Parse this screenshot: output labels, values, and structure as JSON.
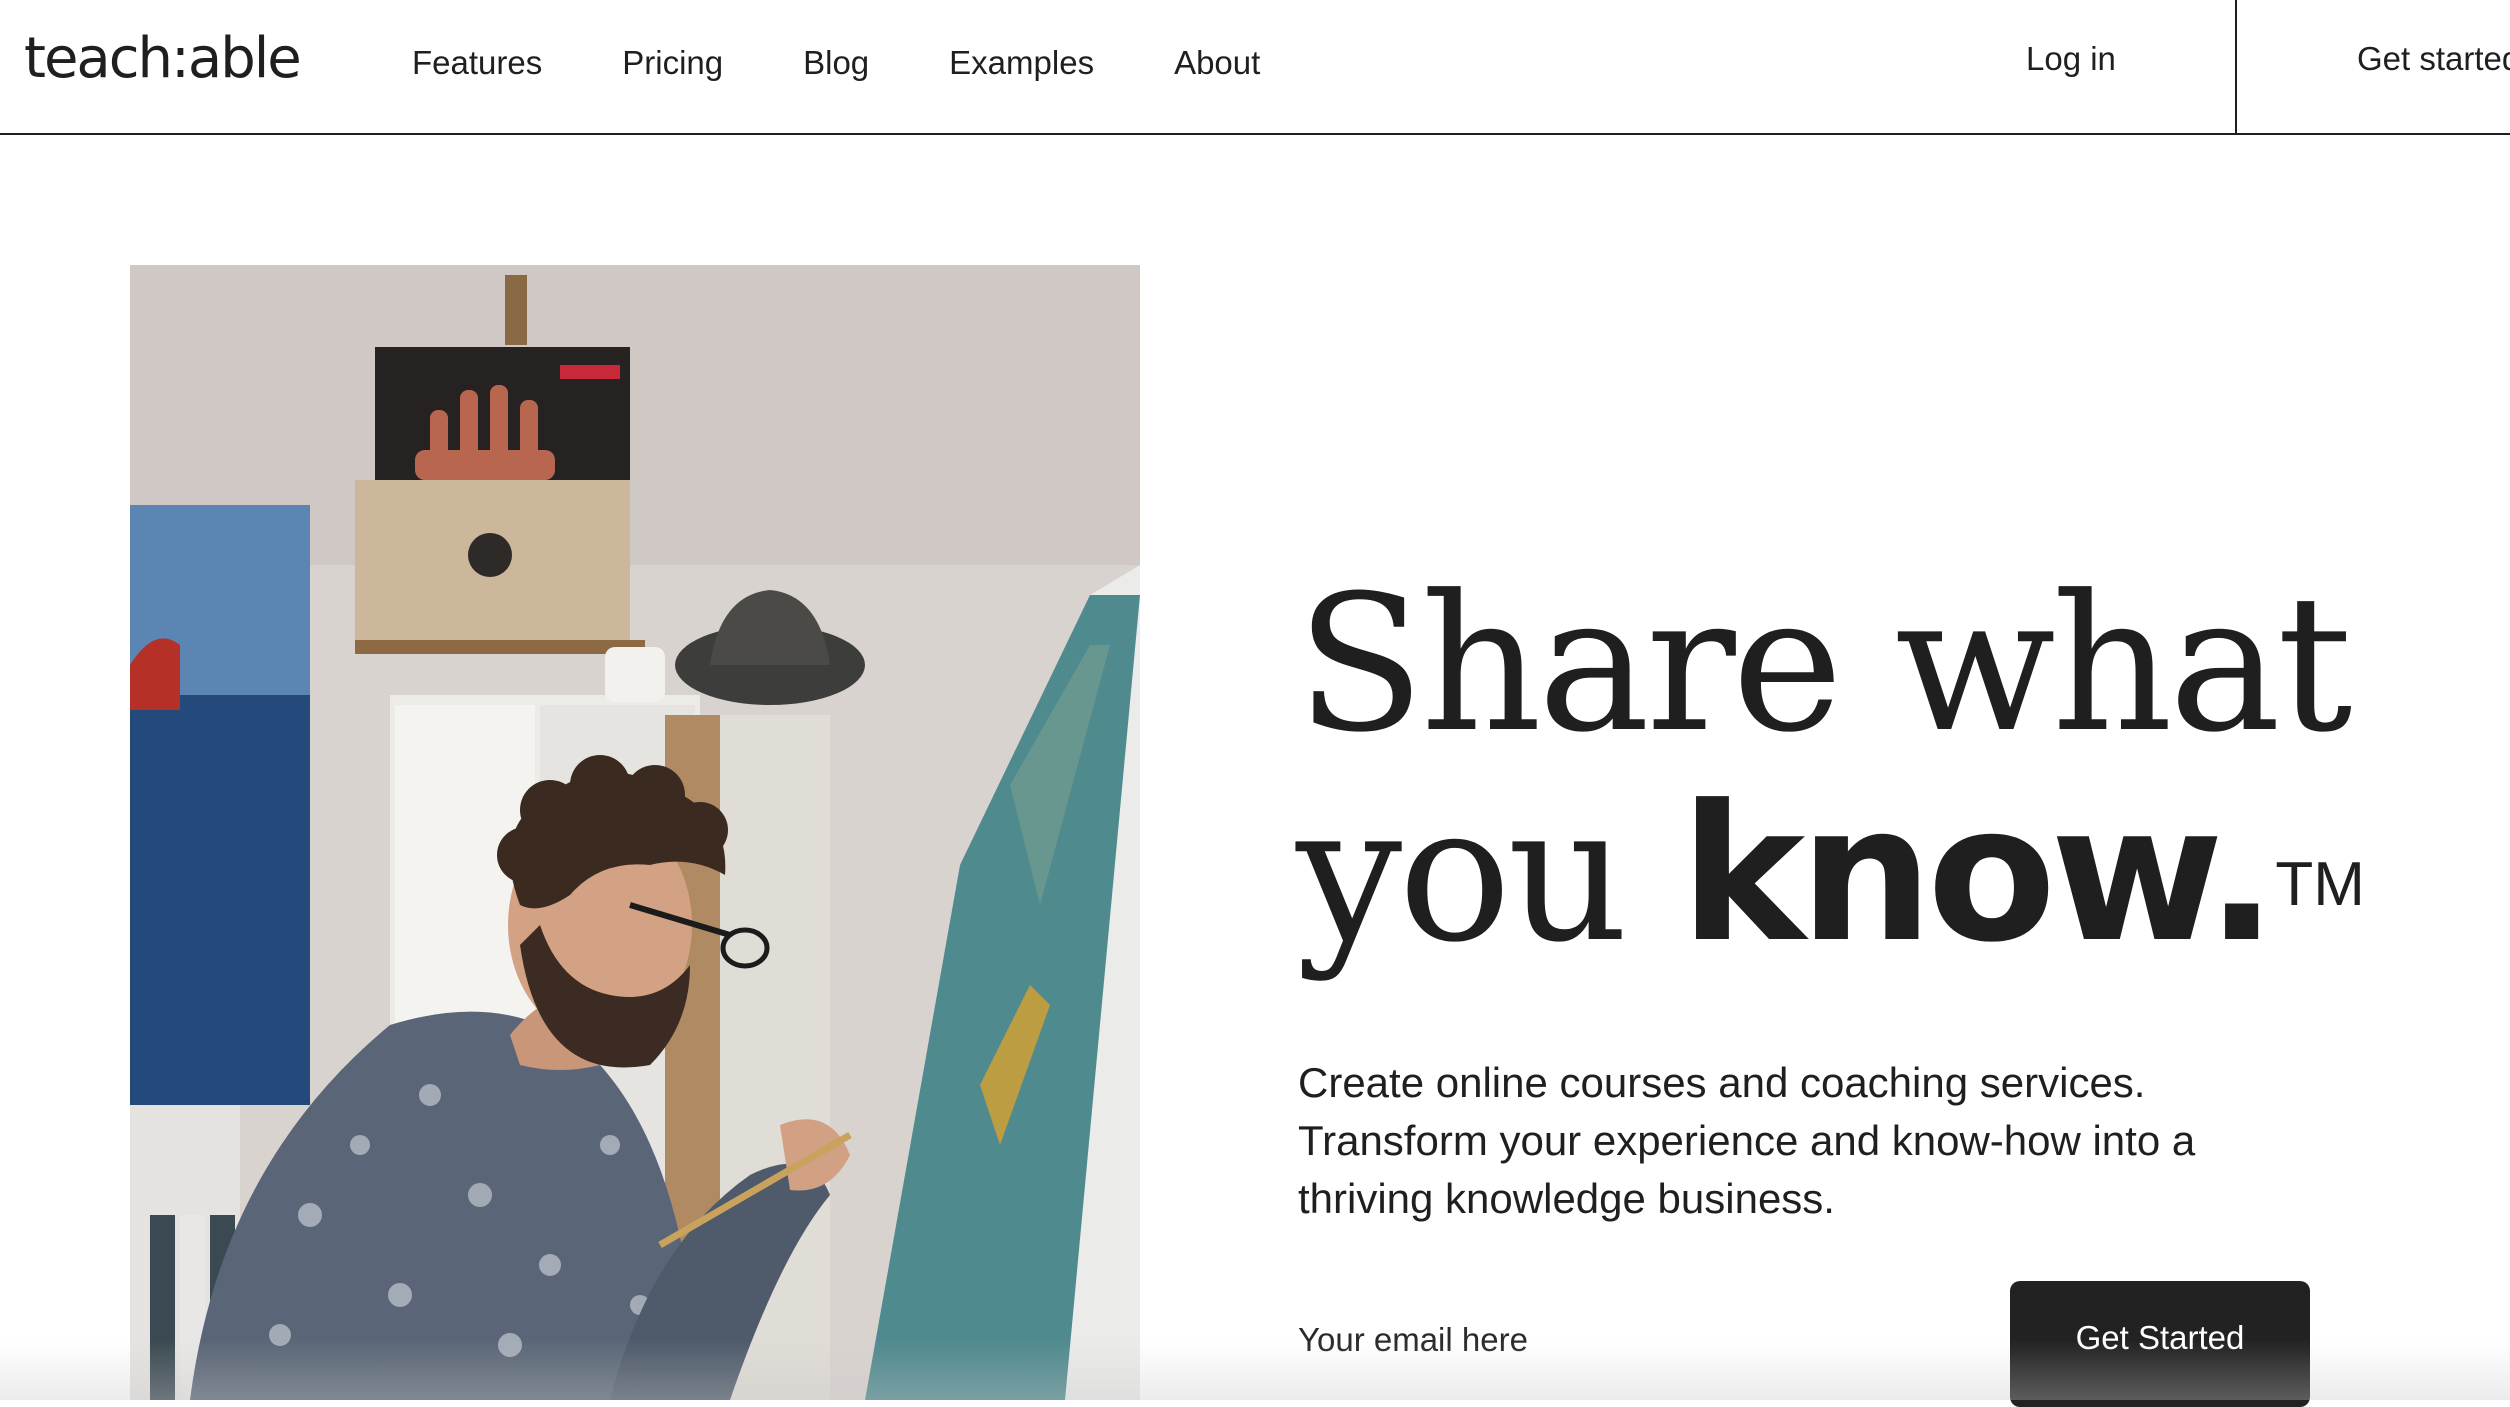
{
  "nav": {
    "logo": "teach:able",
    "links": [
      "Features",
      "Pricing",
      "Blog",
      "Examples",
      "About"
    ],
    "login": "Log in",
    "cta": "Get started"
  },
  "hero": {
    "headline_line1": "Share what",
    "headline_line2_a": "you ",
    "headline_line2_b": "know.",
    "trademark": "TM",
    "subheading": "Create online courses and coaching services. Transform your experience and know-how into a thriving knowledge business.",
    "email_placeholder": "Your email here",
    "cta_button": "Get Started",
    "photo_subject": "man-painting-canvas"
  },
  "colors": {
    "text": "#1f1f1f",
    "button_bg": "#222222",
    "button_text": "#ffffff",
    "background": "#ffffff"
  }
}
